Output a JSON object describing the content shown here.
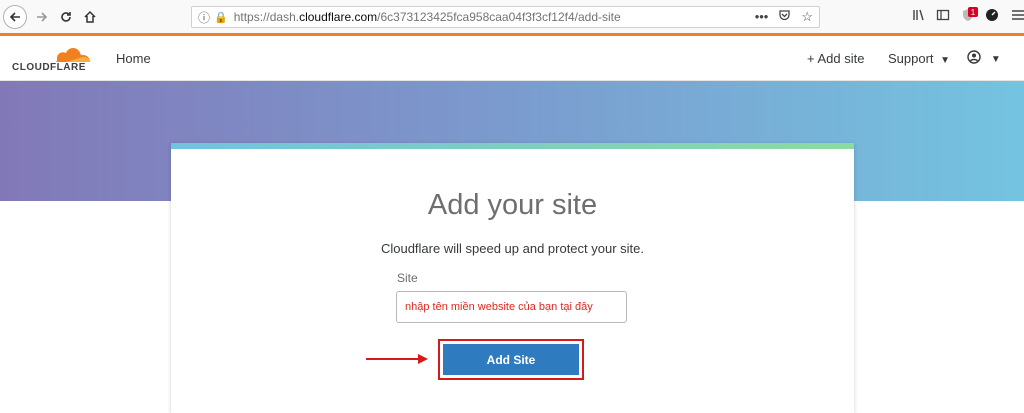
{
  "browser": {
    "url_prefix": "https://dash.",
    "url_domain": "cloudflare.com",
    "url_path": "/6c373123425fca958caa04f3f3cf12f4/add-site",
    "url_actions": "•••",
    "notification_count": "1"
  },
  "header": {
    "logo_text": "CLOUDFLARE",
    "home": "Home",
    "add_site": "+ Add site",
    "support": "Support",
    "user_caret": "▾"
  },
  "card": {
    "title": "Add your site",
    "subtitle": "Cloudflare will speed up and protect your site.",
    "site_label": "Site",
    "site_value": "nhập tên miền website của bạn tại đây",
    "button_label": "Add Site"
  },
  "colors": {
    "accent": "#f38020",
    "button": "#2f7bbf",
    "annotation": "#d7191a"
  }
}
